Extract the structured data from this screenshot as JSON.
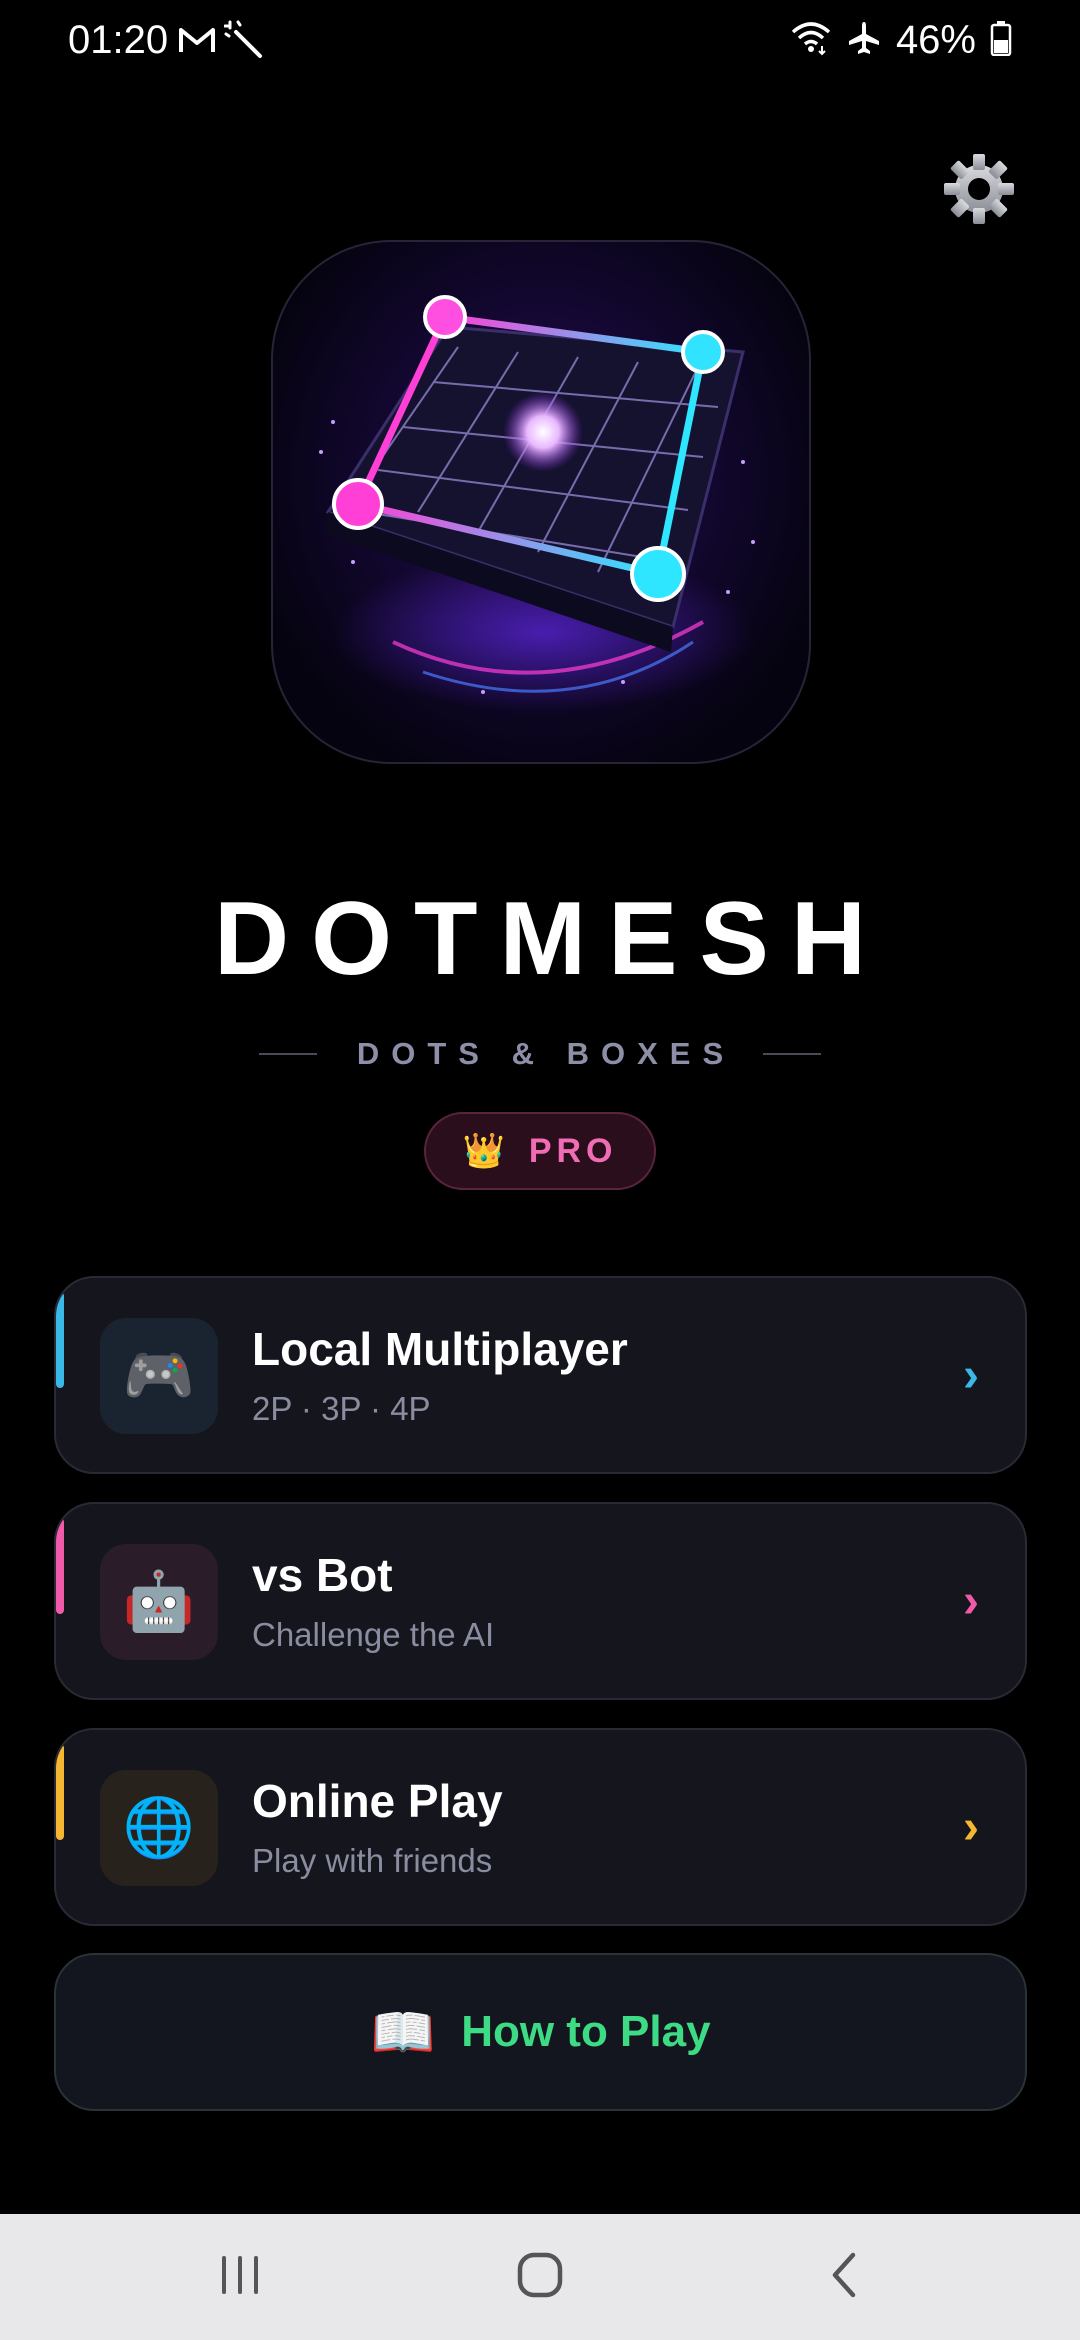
{
  "status_bar": {
    "time": "01:20",
    "battery": "46%",
    "left_icons": [
      "gmail-icon",
      "magic-wand-icon"
    ],
    "right_icons": [
      "wifi-icon",
      "airplane-icon",
      "battery-icon"
    ]
  },
  "header": {
    "settings_icon": "gear-icon"
  },
  "app": {
    "title": "DOTMESH",
    "subtitle": "DOTS & BOXES",
    "badge": {
      "icon": "crown-icon",
      "emoji": "👑",
      "label": "PRO"
    }
  },
  "menu": [
    {
      "title": "Local Multiplayer",
      "subtitle": "2P · 3P · 4P",
      "icon": "gamepad-icon",
      "emoji": "🎮",
      "accent": "#3ab8e8",
      "icon_bg": "#1a2430",
      "chevron": "›"
    },
    {
      "title": "vs Bot",
      "subtitle": "Challenge the AI",
      "icon": "robot-icon",
      "emoji": "🤖",
      "accent": "#f05aa8",
      "icon_bg": "#2a1c28",
      "chevron": "›"
    },
    {
      "title": "Online Play",
      "subtitle": "Play with friends",
      "icon": "globe-icon",
      "emoji": "🌐",
      "accent": "#f5b731",
      "icon_bg": "#27231c",
      "chevron": "›"
    }
  ],
  "how_to_play": {
    "label": "How to Play",
    "icon": "book-icon",
    "emoji": "📖",
    "color": "#3ddc84"
  },
  "nav_bar": {
    "items": [
      "recents-icon",
      "home-icon",
      "back-icon"
    ]
  }
}
